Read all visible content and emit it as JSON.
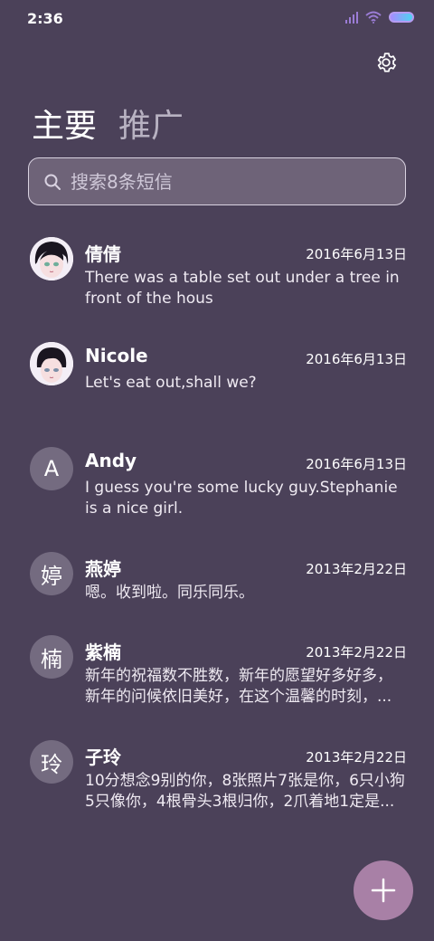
{
  "status_bar": {
    "time": "2:36"
  },
  "tabs": [
    {
      "label": "主要",
      "active": true
    },
    {
      "label": "推广",
      "active": false
    }
  ],
  "search": {
    "placeholder": "搜索8条短信",
    "value": ""
  },
  "conversations": [
    {
      "name": "倩倩",
      "date": "2016年6月13日",
      "message": "There was a table set out under a tree in front of the hous",
      "avatar": "photo-girl"
    },
    {
      "name": "Nicole",
      "date": "2016年6月13日",
      "message": "Let's eat out,shall we?",
      "avatar": "photo-boy"
    },
    {
      "name": "Andy",
      "date": "2016年6月13日",
      "message": "I guess you're some lucky guy.Stephanie is a nice girl.",
      "avatar": "A"
    },
    {
      "name": "燕婷",
      "date": "2013年2月22日",
      "message": "嗯。收到啦。同乐同乐。",
      "avatar": "婷"
    },
    {
      "name": "紫楠",
      "date": "2013年2月22日",
      "message": "新年的祝福数不胜数，新年的愿望好多好多，新年的问候依旧美好，在这个温馨的时刻，...",
      "avatar": "楠"
    },
    {
      "name": "子玲",
      "date": "2013年2月22日",
      "message": "10分想念9别的你，8张照片7张是你，6只小狗5只像你，4根骨头3根归你，2爪着地1定是...",
      "avatar": "玲"
    }
  ],
  "colors": {
    "background": "#4b4159",
    "fab": "#a880a6",
    "search_bg": "#6e6378"
  },
  "icons": {
    "settings": "gear-icon",
    "search": "search-icon",
    "fab": "plus-icon"
  }
}
